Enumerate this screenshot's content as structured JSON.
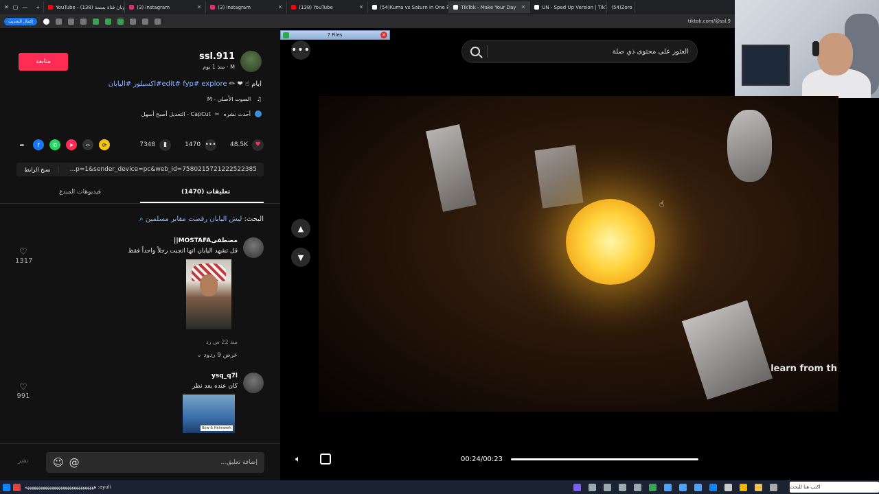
{
  "browser": {
    "tabs": [
      {
        "label": "YouTube - كوبان قناة بسمة (138)",
        "color": "#ff0000"
      },
      {
        "label": "(3) Instagram",
        "color": "#e1306c"
      },
      {
        "label": "(3) Instagram",
        "color": "#e1306c"
      },
      {
        "label": "(138) YouTube",
        "color": "#ff0000"
      },
      {
        "label": "(54)Kuma vs Saturn in One Piec",
        "color": "#ffffff"
      },
      {
        "label": "TikTok - Make Your Day",
        "color": "#ffffff"
      },
      {
        "label": "UN - Sped Up Version | TikTok",
        "color": "#ffffff"
      },
      {
        "label": "(54)Zoro vs",
        "color": "#ffffff"
      }
    ],
    "reload_label": "إكمال التحديث",
    "url": "tiktok.com/@ssl.9"
  },
  "files_popup": {
    "label": "7 Files"
  },
  "post": {
    "follow_label": "متابعة",
    "author_name": "ssl.911",
    "author_sub": "M · منذ 1 يوم",
    "caption_prefix": "ايام",
    "caption_tags": "edit# fyp# explore#اكسبلور #اليابان",
    "sound": "الصوت الأصلي - M",
    "effects": {
      "repost": "أحدث نشره",
      "capcut": "CapCut - التعديل أصبح أسهل"
    },
    "likes": "48.5K",
    "comments": "1470",
    "saves": "7348",
    "copy_link_label": "نسخ الرابط",
    "link_url": "...p=1&sender_device=pc&web_id=7580215721222522385"
  },
  "tabs": {
    "comments_label": "تعليقات (1470)",
    "creator_videos_label": "فيديوهات المبدع"
  },
  "search_hint": {
    "prefix": "البحث:",
    "query": "ليش اليابان رفضت مقابر مسلمين"
  },
  "comments": [
    {
      "name": "مصطفىMOSTAFA||",
      "text": "قل تشهد اليابان انها انجبت رجلاً واحداً فقط",
      "likes": "1317",
      "meta": "منذ 22 س   رد",
      "replies": "عرض 9 ردود ⌄"
    },
    {
      "name": "ysq_q7l",
      "text": "كان عنده بعد نظر",
      "likes": "991",
      "image_label": "Bow & Heimwerk"
    }
  ],
  "comment_bar": {
    "placeholder": "إضافة تعليق...",
    "post_label": "نشر"
  },
  "search": {
    "placeholder": "العثور على محتوى ذي صلة"
  },
  "video": {
    "overlay_text": "learn from th",
    "time": "00:24/00:23"
  },
  "taskbar": {
    "ticker": "هههههههههههههههههههههههههههههههه :ayuli",
    "search_placeholder": "اكتب هنا للبحث"
  }
}
